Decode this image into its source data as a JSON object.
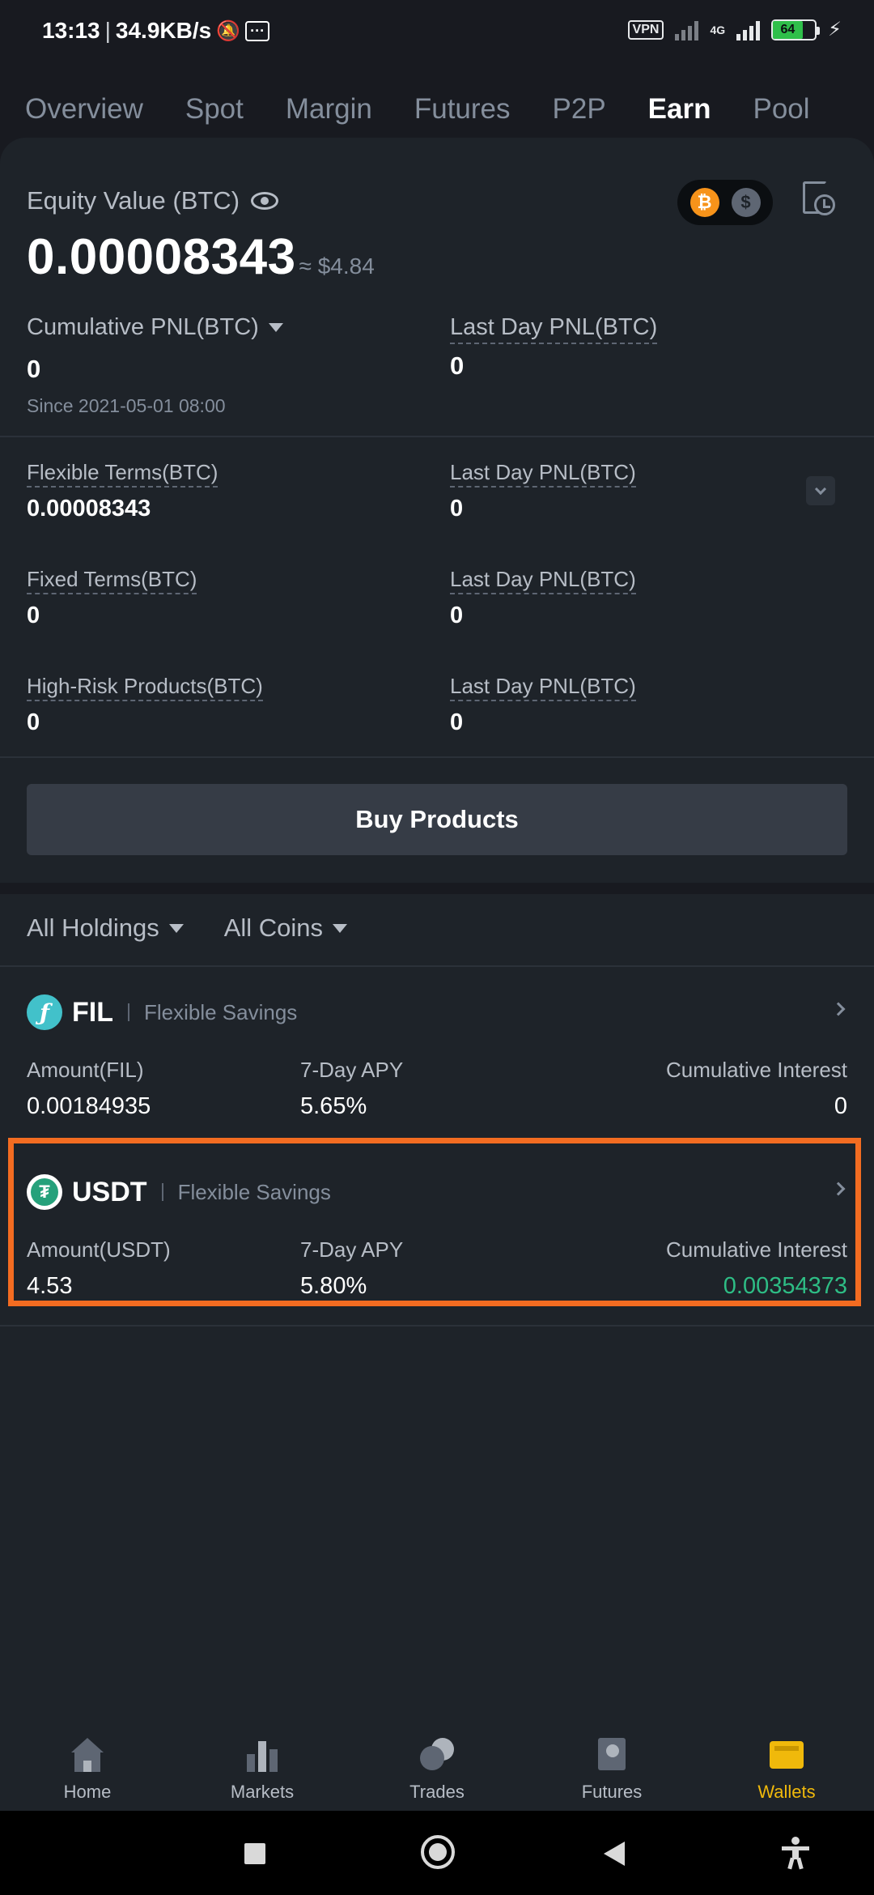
{
  "status_bar": {
    "time": "13:13",
    "speed": "34.9KB/s",
    "vpn": "VPN",
    "network": "4G",
    "battery": "64"
  },
  "tabs": [
    {
      "label": "Overview"
    },
    {
      "label": "Spot"
    },
    {
      "label": "Margin"
    },
    {
      "label": "Futures"
    },
    {
      "label": "P2P"
    },
    {
      "label": "Earn"
    },
    {
      "label": "Pool"
    }
  ],
  "summary": {
    "equity_label": "Equity Value (BTC)",
    "equity_value": "0.00008343",
    "equity_approx": "≈ $4.84",
    "btc_symbol": "₿",
    "usd_symbol": "$",
    "cumulative_label": "Cumulative PNL(BTC)",
    "cumulative_value": "0",
    "since": "Since 2021-05-01 08:00",
    "last_day_label": "Last Day PNL(BTC)",
    "last_day_value": "0"
  },
  "breakdown": [
    {
      "label": "Flexible Terms(BTC)",
      "value": "0.00008343",
      "pnl_label": "Last Day PNL(BTC)",
      "pnl_value": "0"
    },
    {
      "label": "Fixed Terms(BTC)",
      "value": "0",
      "pnl_label": "Last Day PNL(BTC)",
      "pnl_value": "0"
    },
    {
      "label": "High-Risk Products(BTC)",
      "value": "0",
      "pnl_label": "Last Day PNL(BTC)",
      "pnl_value": "0"
    }
  ],
  "buy_button": "Buy Products",
  "filters": {
    "holdings": "All Holdings",
    "coins": "All Coins"
  },
  "holdings": [
    {
      "coin": "FIL",
      "logo": "ƒ",
      "product": "Flexible Savings",
      "amount_label": "Amount(FIL)",
      "amount": "0.00184935",
      "apy_label": "7-Day APY",
      "apy": "5.65%",
      "interest_label": "Cumulative Interest",
      "interest": "0"
    },
    {
      "coin": "USDT",
      "logo": "₮",
      "product": "Flexible Savings",
      "amount_label": "Amount(USDT)",
      "amount": "4.53",
      "apy_label": "7-Day APY",
      "apy": "5.80%",
      "interest_label": "Cumulative Interest",
      "interest": "0.00354373",
      "interest_color": "#2ebd85"
    }
  ],
  "bottom_nav": [
    {
      "label": "Home"
    },
    {
      "label": "Markets"
    },
    {
      "label": "Trades"
    },
    {
      "label": "Futures"
    },
    {
      "label": "Wallets"
    }
  ],
  "colors": {
    "accent": "#f0b90b",
    "background": "#181a20",
    "panel": "#1e2329",
    "positive": "#2ebd85",
    "highlight_border": "#f36c21"
  }
}
